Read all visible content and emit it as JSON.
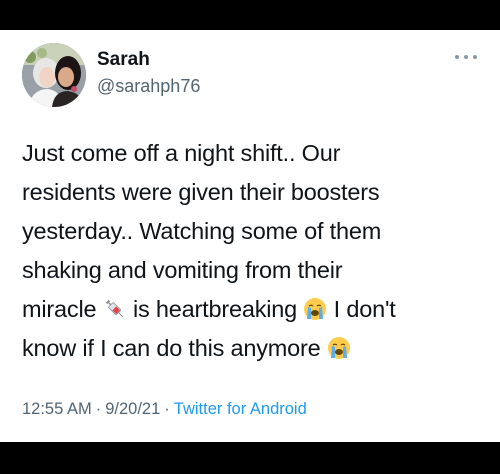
{
  "author": {
    "display_name": "Sarah",
    "handle": "@sarahph76"
  },
  "tweet": {
    "segments": [
      "Just come off a night shift.. Our",
      "residents were given their boosters",
      "yesterday.. Watching some of them",
      "shaking and vomiting from their",
      "miracle ",
      " is heartbreaking ",
      " I don't",
      "know if I can do this anymore "
    ],
    "emojis": [
      "syringe-emoji",
      "loudly-crying-face-emoji",
      "loudly-crying-face-emoji"
    ]
  },
  "meta": {
    "time": "12:55 AM",
    "date": "9/20/21",
    "source": "Twitter for Android",
    "separator": "·"
  },
  "colors": {
    "link": "#1d9bf0",
    "secondary": "#536471",
    "text": "#0f1419",
    "frame": "#000000"
  },
  "icons": [
    "more-options-icon"
  ]
}
